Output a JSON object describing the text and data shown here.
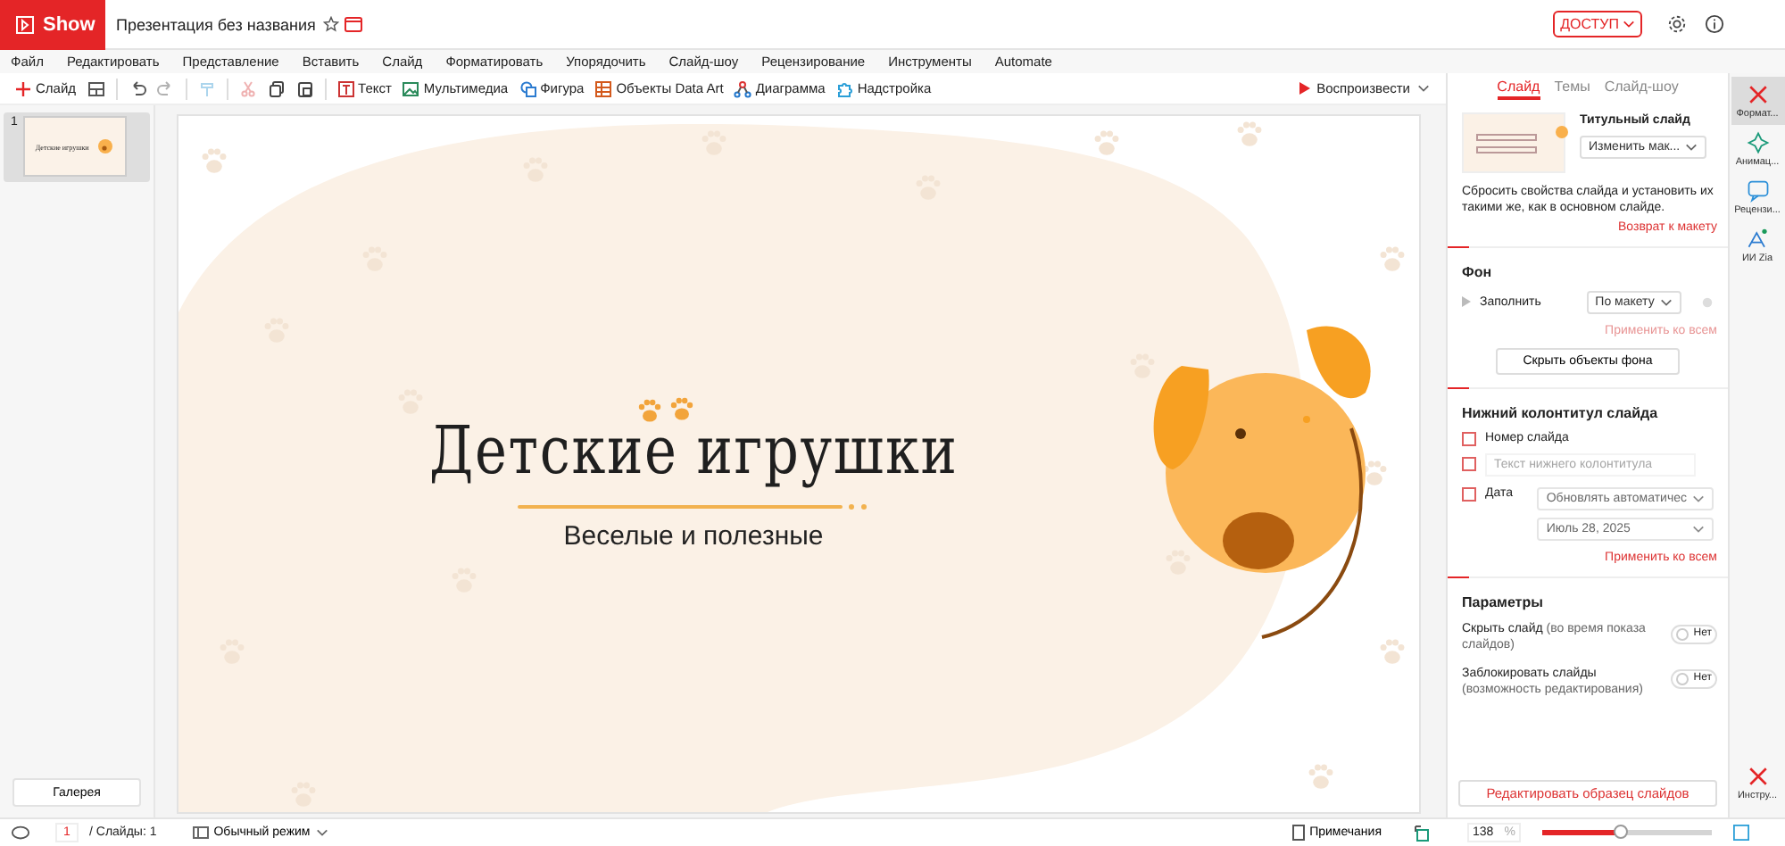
{
  "app": {
    "logo": "Show",
    "document_title": "Презентация без названия",
    "share_button": "ДОСТУП"
  },
  "menu": [
    "Файл",
    "Редактировать",
    "Представление",
    "Вставить",
    "Слайд",
    "Форматировать",
    "Упорядочить",
    "Слайд-шоу",
    "Рецензирование",
    "Инструменты",
    "Automate"
  ],
  "toolbar": {
    "items": [
      {
        "kind": "labeled",
        "label": "Слайд",
        "disabled": false
      },
      {
        "kind": "icon",
        "disabled": false
      },
      {
        "kind": "separator"
      },
      {
        "kind": "icon",
        "disabled": false
      },
      {
        "kind": "icon",
        "disabled": true
      },
      {
        "kind": "separator"
      },
      {
        "kind": "icon",
        "disabled": true
      },
      {
        "kind": "separator"
      },
      {
        "kind": "icon",
        "disabled": true
      },
      {
        "kind": "icon",
        "disabled": false
      },
      {
        "kind": "icon",
        "disabled": false
      },
      {
        "kind": "separator"
      },
      {
        "kind": "labeled",
        "label": "Текст",
        "disabled": false
      },
      {
        "kind": "labeled",
        "label": "Мультимедиа",
        "disabled": false
      },
      {
        "kind": "labeled",
        "label": "Фигура",
        "disabled": false
      },
      {
        "kind": "labeled",
        "label": "Объекты Data Art",
        "disabled": false
      },
      {
        "kind": "labeled",
        "label": "Диаграмма",
        "disabled": false
      },
      {
        "kind": "labeled",
        "label": "Надстройка",
        "disabled": false
      }
    ],
    "play_button": "Воспроизвести"
  },
  "thumbnails": [
    {
      "number": "1",
      "title": "Детские игрушки",
      "selected": true
    }
  ],
  "gallery_button": "Галерея",
  "slide": {
    "title": "Детские игрушки",
    "subtitle": "Веселые и полезные"
  },
  "panel": {
    "tabs": [
      {
        "label": "Слайд",
        "selected": true
      },
      {
        "label": "Темы",
        "selected": false
      },
      {
        "label": "Слайд-шоу",
        "selected": false
      }
    ],
    "layout_name": "Титульный слайд",
    "layout_dropdown": "Изменить мак...",
    "reset_text": "Сбросить свойства слайда и установить их такими же, как в основном слайде.",
    "reset_link": "Возврат к макету",
    "background": {
      "heading": "Фон",
      "fill_label": "Заполнить",
      "fill_dropdown": "По макету",
      "apply_all": {
        "label": "Применить ко всем",
        "disabled": true
      },
      "hide_button": "Скрыть объекты фона"
    },
    "footer": {
      "heading": "Нижний колонтитул слайда",
      "options": [
        {
          "kind": "checkbox",
          "label": "Номер слайда",
          "checked": false
        },
        {
          "kind": "field",
          "placeholder": "Текст нижнего колонтитула",
          "checked": false,
          "disabled": true
        },
        {
          "kind": "date",
          "label": "Дата",
          "checked": false,
          "dropdowns": [
            "Обновлять автоматичес",
            "Июль 28, 2025"
          ],
          "disabled": true
        }
      ],
      "apply_all": {
        "label": "Применить ко всем",
        "disabled": false
      }
    },
    "parameters": {
      "heading": "Параметры",
      "toggles": [
        {
          "label": "Скрыть слайд",
          "note": "(во время показа слайдов)",
          "on": false,
          "state": "Нет"
        },
        {
          "label": "Заблокировать слайды",
          "note": "(возможность редактирования)",
          "on": false,
          "state": "Нет"
        }
      ]
    },
    "master_button": "Редактировать образец слайдов"
  },
  "side_strip": [
    {
      "label": "Формат...",
      "selected": true
    },
    {
      "label": "Анимац...",
      "selected": false
    },
    {
      "label": "Рецензи...",
      "selected": false
    },
    {
      "label": "ИИ Zia",
      "selected": false
    }
  ],
  "side_strip_bottom": {
    "label": "Инстру..."
  },
  "status_bar": {
    "page": "1",
    "slides_count": "/ Слайды: 1",
    "view_mode": "Обычный режим",
    "notes": "Примечания",
    "zoom": "138",
    "zoom_unit": "%",
    "zoom_slider": {
      "level": 0.43
    }
  }
}
